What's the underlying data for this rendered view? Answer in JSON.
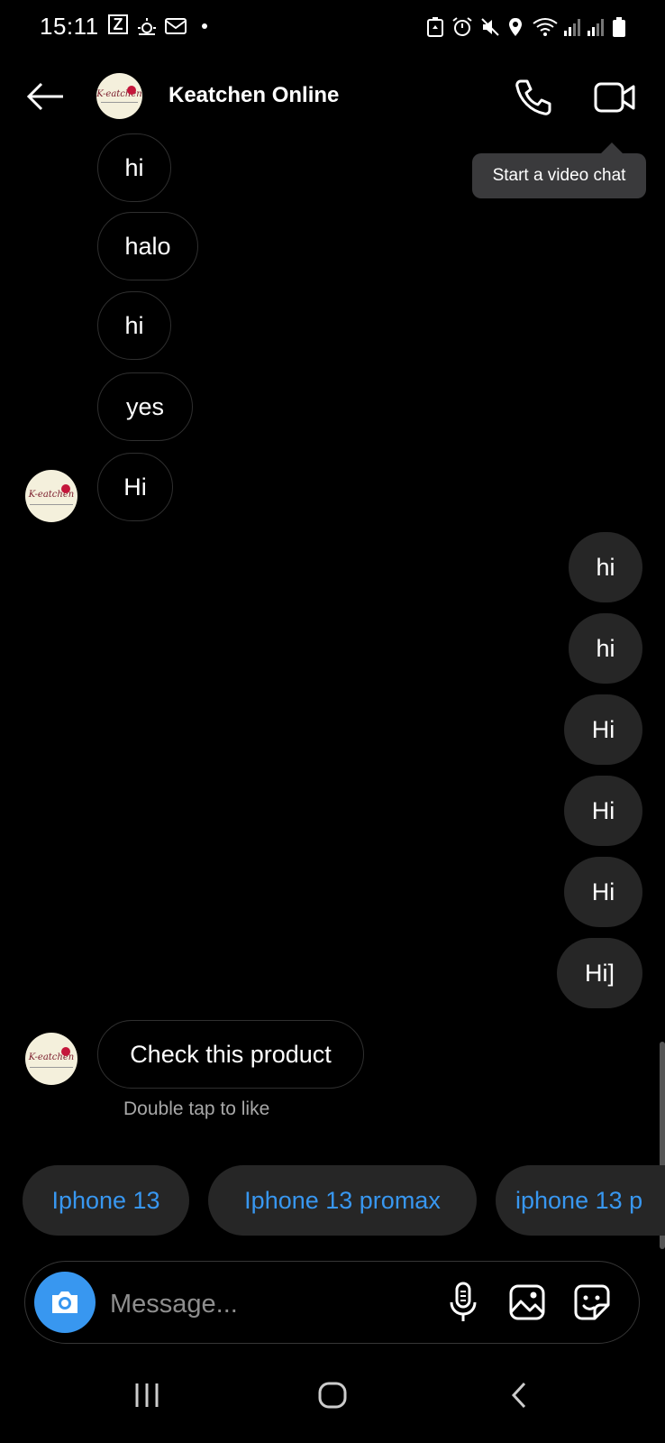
{
  "status_bar": {
    "time": "15:11",
    "left_icons": [
      "z-app-icon",
      "weather-icon",
      "mail-icon",
      "dot-icon"
    ],
    "right_icons": [
      "battery-saver-icon",
      "alarm-icon",
      "mute-icon",
      "location-icon",
      "wifi-icon",
      "signal-icon",
      "signal-icon",
      "battery-icon"
    ]
  },
  "header": {
    "title": "Keatchen Online",
    "avatar_logo": "K-eatchen",
    "call_icon": "phone-icon",
    "video_icon": "video-camera-icon",
    "tooltip": "Start a video chat"
  },
  "messages_incoming": [
    {
      "text": "hi"
    },
    {
      "text": "halo"
    },
    {
      "text": "hi"
    },
    {
      "text": "yes"
    },
    {
      "text": "Hi"
    }
  ],
  "messages_outgoing": [
    {
      "text": "hi"
    },
    {
      "text": "hi"
    },
    {
      "text": "Hi"
    },
    {
      "text": "Hi"
    },
    {
      "text": "Hi"
    },
    {
      "text": "Hi]"
    }
  ],
  "last_incoming": {
    "text": "Check this product",
    "hint": "Double tap to like"
  },
  "quick_replies": [
    "Iphone 13",
    "Iphone 13 promax",
    "iphone 13 p"
  ],
  "composer": {
    "placeholder": "Message...",
    "icons": [
      "camera-icon",
      "microphone-icon",
      "gallery-icon",
      "sticker-icon"
    ]
  },
  "nav_bar": {
    "icons": [
      "recent-apps-icon",
      "home-icon",
      "back-icon"
    ]
  },
  "colors": {
    "background": "#000000",
    "bubble_out": "#262626",
    "accent": "#3897f0",
    "tooltip": "#3a3a3c"
  }
}
